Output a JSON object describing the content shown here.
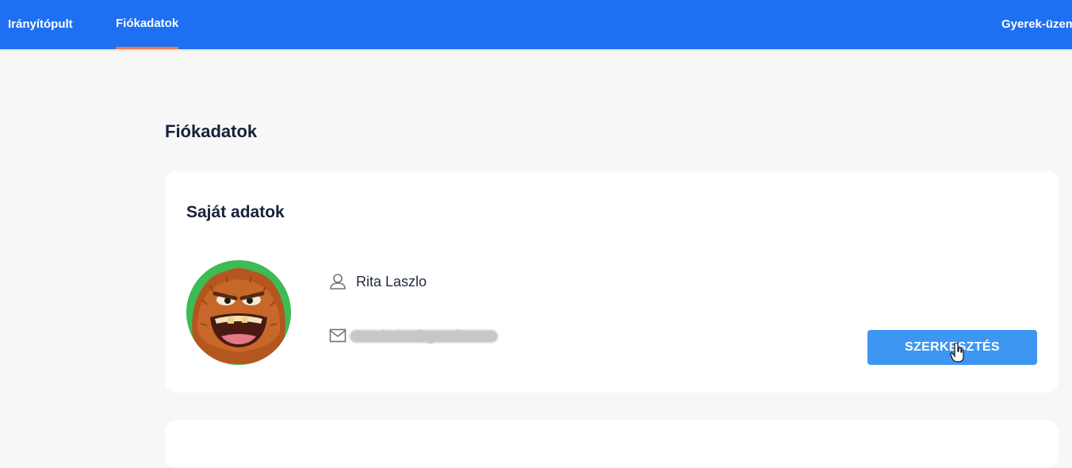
{
  "nav": {
    "items": [
      {
        "label": "Irányítópult"
      },
      {
        "label": "Fiókadatok"
      },
      {
        "label": "Gyerek-üzem"
      }
    ]
  },
  "page": {
    "title": "Fiókadatok"
  },
  "card": {
    "title": "Saját adatok",
    "name": "Rita Laszlo",
    "email": "laszlorita@gmail.com",
    "edit_label": "SZERKESZTÉS"
  },
  "colors": {
    "topbar": "#1e6ff2",
    "active_underline": "#ee7a45",
    "button": "#3d96f2",
    "avatar_bg": "#3dbb55"
  }
}
